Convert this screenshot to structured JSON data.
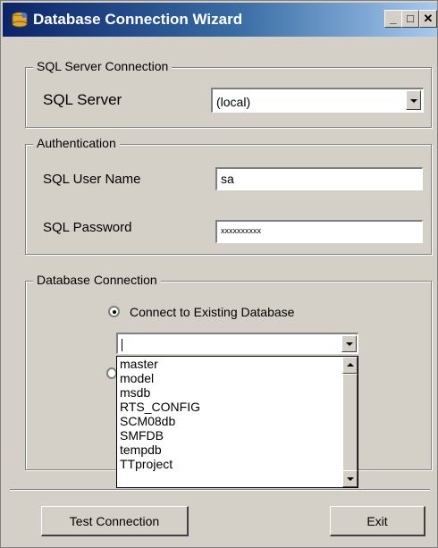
{
  "window": {
    "title": "Database Connection Wizard",
    "minimize_glyph": "_",
    "maximize_glyph": "□",
    "close_glyph": "✕",
    "icon": "database-icon"
  },
  "sql_server_group": {
    "legend": "SQL Server Connection",
    "server_label": "SQL Server",
    "server_value": "(local)"
  },
  "auth_group": {
    "legend": "Authentication",
    "user_label": "SQL User Name",
    "user_value": "sa",
    "password_label": "SQL Password",
    "password_value": "xxxxxxxxxx"
  },
  "db_group": {
    "legend": "Database Connection",
    "existing_radio_label": "Connect to Existing Database",
    "existing_radio_checked": true,
    "db_combo_value": "",
    "db_list": [
      "master",
      "model",
      "msdb",
      "RTS_CONFIG",
      "SCM08db",
      "SMFDB",
      "tempdb",
      "TTproject"
    ]
  },
  "footer": {
    "test_button": "Test Connection",
    "exit_button": "Exit"
  }
}
